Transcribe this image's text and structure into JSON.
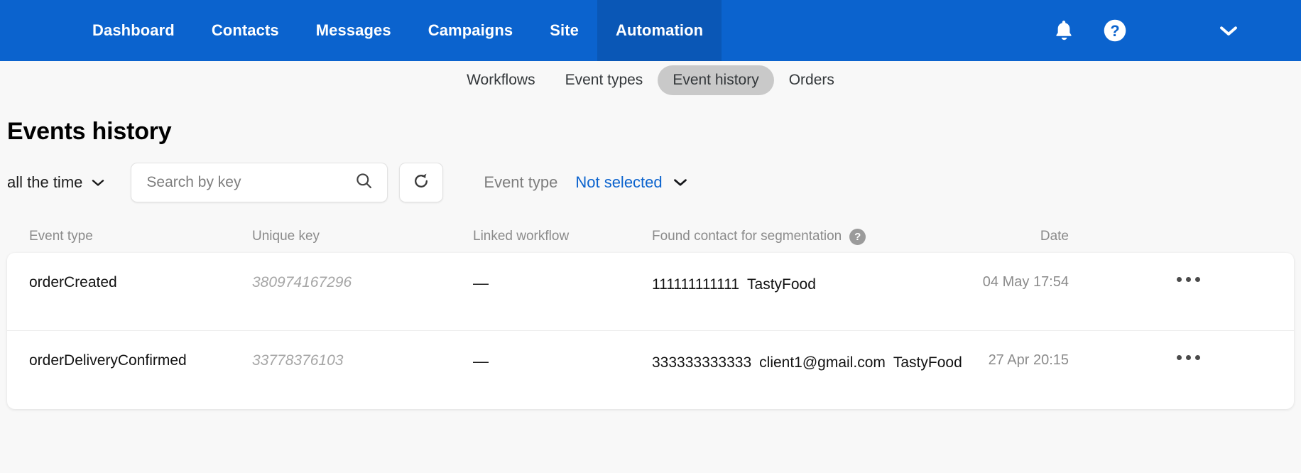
{
  "topnav": {
    "brand_color": "#0b63ce",
    "active_color": "#0a57b6",
    "items": [
      {
        "label": "Dashboard",
        "active": false
      },
      {
        "label": "Contacts",
        "active": false
      },
      {
        "label": "Messages",
        "active": false
      },
      {
        "label": "Campaigns",
        "active": false
      },
      {
        "label": "Site",
        "active": false
      },
      {
        "label": "Automation",
        "active": true
      }
    ],
    "icons": {
      "notifications": "bell-icon",
      "help": "question-circle-icon",
      "account": "chevron-down-icon"
    }
  },
  "subnav": {
    "items": [
      {
        "label": "Workflows",
        "active": false
      },
      {
        "label": "Event types",
        "active": false
      },
      {
        "label": "Event history",
        "active": true
      },
      {
        "label": "Orders",
        "active": false
      }
    ],
    "active_pill_color": "#c9c9c9"
  },
  "page": {
    "title": "Events history"
  },
  "filters": {
    "time_range": "all the time",
    "search_placeholder": "Search by key",
    "search_value": "",
    "refresh_icon": "refresh-icon",
    "event_type_label": "Event type",
    "event_type_value": "Not selected",
    "event_type_link_color": "#0b63ce"
  },
  "table": {
    "columns": {
      "event_type": "Event type",
      "unique_key": "Unique key",
      "linked_workflow": "Linked workflow",
      "found_contact": "Found contact for segmentation",
      "found_contact_help": "?",
      "date": "Date"
    },
    "rows": [
      {
        "event_type": "orderCreated",
        "unique_key": "380974167296",
        "linked_workflow": "—",
        "found_contact_lines": [
          "111111111111",
          "TastyFood"
        ],
        "date": "04 May 17:54",
        "menu": "…"
      },
      {
        "event_type": "orderDeliveryConfirmed",
        "unique_key": "33778376103",
        "linked_workflow": "—",
        "found_contact_lines": [
          "333333333333",
          "client1@gmail.com",
          "TastyFood"
        ],
        "date": "27 Apr 20:15",
        "menu": "…"
      }
    ]
  }
}
